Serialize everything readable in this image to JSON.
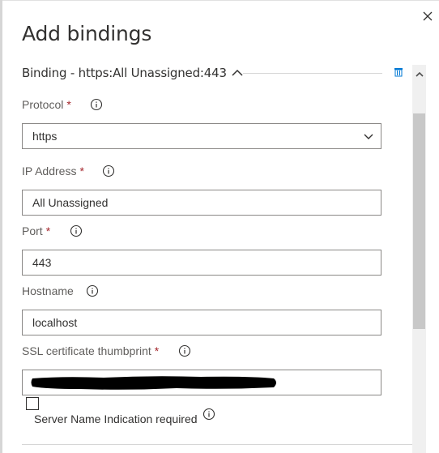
{
  "panel": {
    "title": "Add bindings",
    "binding_header": "Binding - https:All Unassigned:443"
  },
  "form": {
    "protocol": {
      "label": "Protocol",
      "required_mark": "*",
      "value": "https"
    },
    "ip_address": {
      "label": "IP Address",
      "required_mark": "*",
      "value": "All Unassigned"
    },
    "port": {
      "label": "Port",
      "required_mark": "*",
      "value": "443"
    },
    "hostname": {
      "label": "Hostname",
      "value": "localhost"
    },
    "ssl_thumbprint": {
      "label": "SSL certificate thumbprint",
      "required_mark": "*",
      "value": ""
    },
    "sni": {
      "label": "Server Name Indication required",
      "checked": false
    }
  },
  "icons": {
    "close": "close-icon",
    "collapse": "chevron-up-icon",
    "delete": "delete-icon",
    "info": "info-icon",
    "dropdown": "chevron-down-icon",
    "scroll_up": "scroll-up-icon"
  },
  "colors": {
    "required": "#a4262c",
    "accent": "#0078d4",
    "border": "#8a8886"
  }
}
